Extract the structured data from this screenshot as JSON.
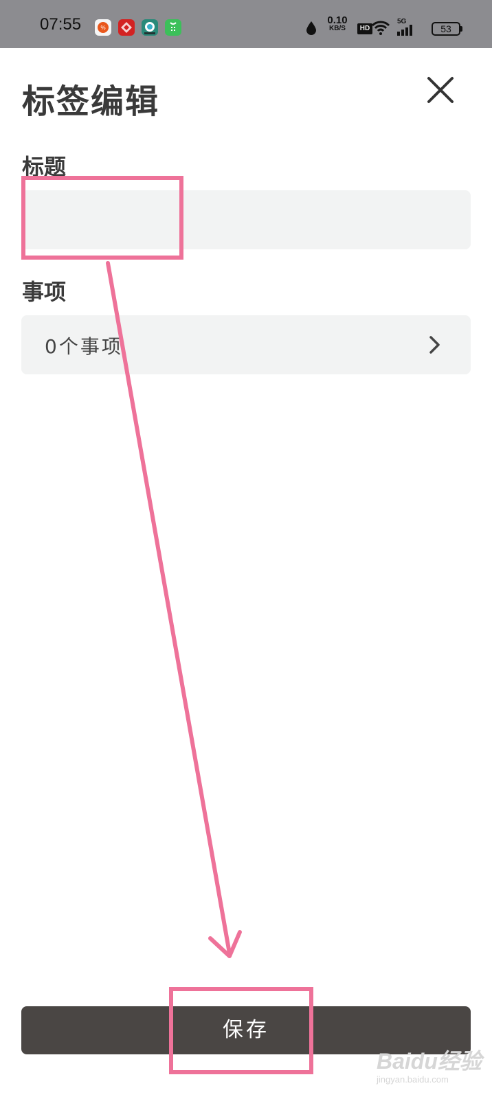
{
  "status_bar": {
    "time": "07:55",
    "net_speed_value": "0.10",
    "net_speed_unit": "KB/S",
    "hd_label": "HD",
    "network_label": "5G",
    "battery": "53"
  },
  "header": {
    "title": "标签编辑"
  },
  "form": {
    "title_label": "标题",
    "title_value": "",
    "items_label": "事项",
    "items_count_text": "0个事项"
  },
  "footer": {
    "save_label": "保存"
  },
  "watermark": {
    "brand": "Baidu经验",
    "url": "jingyan.baidu.com"
  },
  "colors": {
    "status_bar_bg": "#8c8c90",
    "field_bg": "#f2f3f3",
    "save_button_bg": "#4a4644",
    "annotation": "#ee7299"
  }
}
